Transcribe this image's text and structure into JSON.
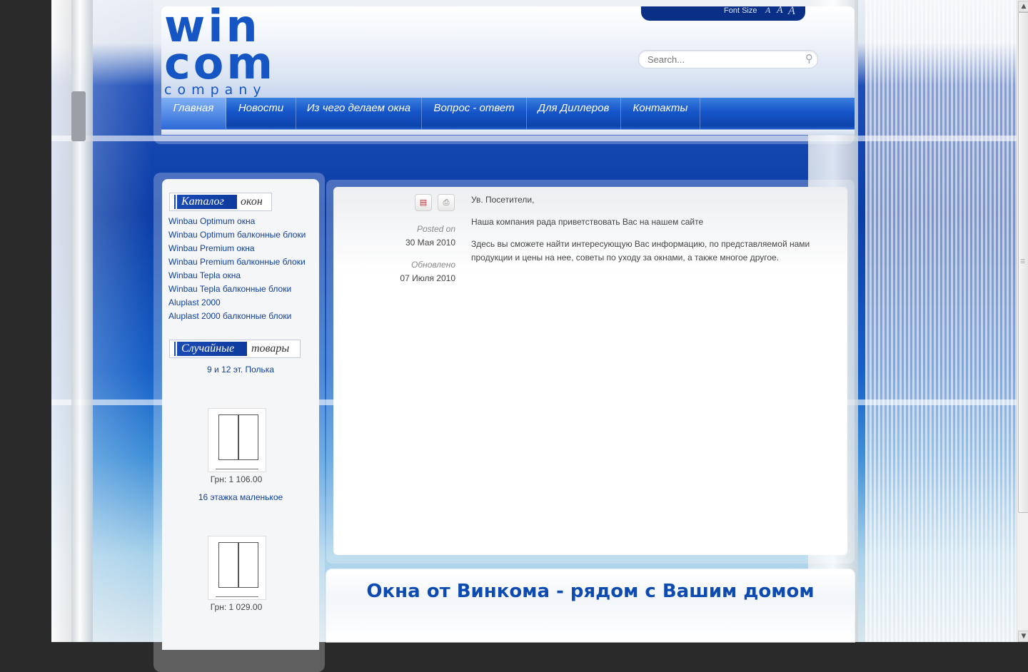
{
  "header": {
    "font_size_label": "Font Size",
    "font_size_options": [
      "A",
      "A",
      "A"
    ],
    "search": {
      "placeholder": "Search..."
    },
    "logo": {
      "line1": "win",
      "line2": "com",
      "line3": "company"
    }
  },
  "nav": [
    {
      "label": "Главная",
      "active": true
    },
    {
      "label": "Новости"
    },
    {
      "label": "Из чего делаем окна"
    },
    {
      "label": "Вопрос - ответ"
    },
    {
      "label": "Для Диллеров"
    },
    {
      "label": "Контакты"
    }
  ],
  "catalog": {
    "title_accent": "Каталог",
    "title_rest": "окон",
    "items": [
      "Winbau Optimum окна",
      "Winbau Optimum балконные блоки",
      "Winbau Premium окна",
      "Winbau Premium балконные блоки",
      "Winbau Tepla окна",
      "Winbau Tepla балконные блоки",
      "Aluplast 2000",
      "Aluplast 2000 балконные блоки"
    ]
  },
  "random": {
    "title_accent": "Случайные",
    "title_rest": "товары",
    "products": [
      {
        "name": "9 и 12 эт. Полька",
        "price": "Грн: 1 106.00"
      },
      {
        "name": "16 этажка маленькое",
        "price": "Грн: 1 029.00"
      }
    ]
  },
  "article": {
    "posted_label": "Posted on",
    "posted_date": "30 Мая 2010",
    "updated_label": "Обновлено",
    "updated_date": "07 Июля 2010",
    "paragraphs": [
      "Ув. Посетители,",
      "Наша компания рада приветствовать Вас на нашем сайте",
      "Здесь вы сможете найти интересующую Вас информацию, по представляемой нами продукции и цены на нее, советы по уходу за окнами, а также многое другое."
    ]
  },
  "banner": {
    "slogan": "Окна от Винкома - рядом с Вашим домом"
  },
  "colors": {
    "brand_blue": "#1555c4",
    "link": "#0d3f9e"
  }
}
